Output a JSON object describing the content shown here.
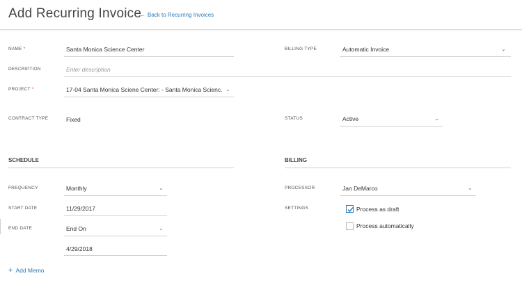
{
  "header": {
    "title": "Add Recurring Invoice",
    "back_link": "Back to Recurring Invoices"
  },
  "form": {
    "name": {
      "label": "NAME",
      "required_marker": "*",
      "value": "Santa Monica Science Center"
    },
    "billing_type": {
      "label": "BILLING TYPE",
      "value": "Automatic Invoice"
    },
    "description": {
      "label": "DESCRIPTION",
      "placeholder": "Enter description"
    },
    "project": {
      "label": "PROJECT",
      "required_marker": "*",
      "value": "17-04 Santa Monica Sciene Center: - Santa Monica Scienc..."
    },
    "contract_type": {
      "label": "CONTRACT TYPE",
      "value": "Fixed"
    },
    "status": {
      "label": "STATUS",
      "value": "Active"
    }
  },
  "schedule": {
    "title": "SCHEDULE",
    "frequency": {
      "label": "FREQUENCY",
      "value": "Monthly"
    },
    "start_date": {
      "label": "START DATE",
      "value": "11/29/2017"
    },
    "end_date": {
      "label": "END DATE",
      "value": "End On",
      "date_value": "4/29/2018"
    }
  },
  "billing": {
    "title": "BILLING",
    "processor": {
      "label": "PROCESSOR",
      "value": "Jan DeMarco"
    },
    "settings": {
      "label": "SETTINGS",
      "options": [
        {
          "label": "Process as draft",
          "checked": true
        },
        {
          "label": "Process automatically",
          "checked": false
        }
      ]
    }
  },
  "actions": {
    "add_memo": "Add Memo"
  },
  "colors": {
    "accent": "#2a7ab8",
    "required": "#d9342b",
    "line": "#cfcfcf"
  }
}
